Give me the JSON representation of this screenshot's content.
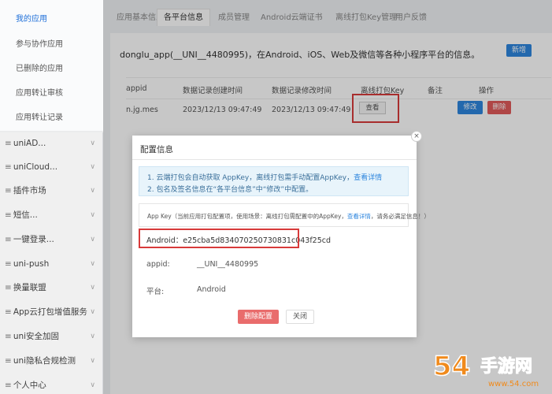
{
  "sidebar": {
    "sub_items": [
      {
        "label": "我的应用"
      },
      {
        "label": "参与协作应用"
      },
      {
        "label": "已删除的应用"
      },
      {
        "label": "应用转让审核"
      },
      {
        "label": "应用转让记录"
      }
    ],
    "menu_items": [
      {
        "label": "uniAD..."
      },
      {
        "label": "uniCloud..."
      },
      {
        "label": "插件市场"
      },
      {
        "label": "短信..."
      },
      {
        "label": "一键登录..."
      },
      {
        "label": "uni-push"
      },
      {
        "label": "换量联盟"
      },
      {
        "label": "App云打包增值服务"
      },
      {
        "label": "uni安全加固"
      },
      {
        "label": "uni隐私合规检测"
      },
      {
        "label": "个人中心"
      }
    ]
  },
  "tabs": [
    {
      "label": "应用基本信息"
    },
    {
      "label": "各平台信息"
    },
    {
      "label": "成员管理"
    },
    {
      "label": "Android云端证书"
    },
    {
      "label": "离线打包Key管理"
    },
    {
      "label": "用户反馈"
    }
  ],
  "panel": {
    "title": "donglu_app(__UNI__4480995)，在Android、iOS、Web及微信等各种小程序平台的信息。",
    "new_button": "新增",
    "columns": [
      "appid",
      "数据记录创建时间",
      "数据记录修改时间",
      "离线打包Key",
      "备注",
      "操作"
    ],
    "row": {
      "appid": "n.jg.mes",
      "created": "2023/12/13 09:47:49",
      "modified": "2023/12/13 09:47:49",
      "view": "查看",
      "edit": "修改",
      "delete": "删除"
    }
  },
  "modal": {
    "title": "配置信息",
    "close_icon": "×",
    "info_line1": "1. 云端打包会自动获取 AppKey，离线打包需手动配置AppKey，",
    "info_line1_link": "查看详情",
    "info_line2": "2. 包名及签名信息在“各平台信息”中“修改”中配置。",
    "appkey_text": "App Key（当前应用打包配置项，使用场景：离线打包需配置中的AppKey，",
    "appkey_link": "查看详情",
    "appkey_tail": "，请务必满足信息！）",
    "android_key": "Android：e25cba5d834070250730831c043f25cd",
    "appid_label": "appid:",
    "appid_value": "__UNI__4480995",
    "platform_label": "平台:",
    "platform_value": "Android",
    "delete_button": "删除配置",
    "close_button": "关闭"
  },
  "watermark": {
    "text": "54手游网",
    "sub": "www.54.com"
  },
  "colors": {
    "accent": "#2e86de",
    "danger": "#e05a5a",
    "highlight_box": "#d83a3a"
  }
}
